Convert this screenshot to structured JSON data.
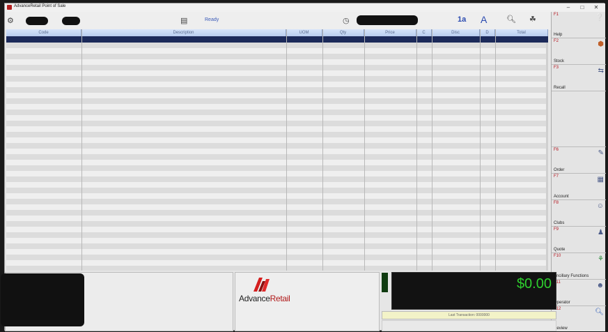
{
  "window": {
    "title": "AdvanceRetail Point of Sale",
    "controls": {
      "minimize": "–",
      "maximize": "□",
      "close": "✕"
    }
  },
  "toolbar": {
    "status": "Ready",
    "icons": [
      "settings-icon",
      "register-icon",
      "clock-icon",
      "font-size-icon",
      "font-icon",
      "search-icon",
      "tree-icon"
    ],
    "font_size_glyph": "1a",
    "font_glyph": "A"
  },
  "grid": {
    "columns": [
      "Code",
      "Description",
      "UOM",
      "Qty",
      "Price",
      "C",
      "Disc",
      "D",
      "Total"
    ],
    "rows": []
  },
  "function_keys": [
    {
      "key": "F1",
      "label": "Help"
    },
    {
      "key": "F2",
      "label": "Stock"
    },
    {
      "key": "F3",
      "label": "Recall"
    },
    {
      "key": "",
      "label": ""
    },
    {
      "key": "F6",
      "label": "Order"
    },
    {
      "key": "F7",
      "label": "Account"
    },
    {
      "key": "F8",
      "label": "Clubs"
    },
    {
      "key": "F9",
      "label": "Quote"
    },
    {
      "key": "F10",
      "label": "Ancillary Functions"
    },
    {
      "key": "F11",
      "label": "Operator"
    },
    {
      "key": "F12",
      "label": "Review"
    }
  ],
  "logo": {
    "brand_a": "Advance",
    "brand_b": "Retail"
  },
  "totals": {
    "amount": "$0.00",
    "last_transaction": "Last Transaction: 0000000"
  },
  "colors": {
    "grid_header": "#c7d8f5",
    "selection": "#1c2a5a",
    "total_text": "#2ecf2e",
    "fkey_text": "#b4141e",
    "status_text": "#3a5ab8"
  }
}
